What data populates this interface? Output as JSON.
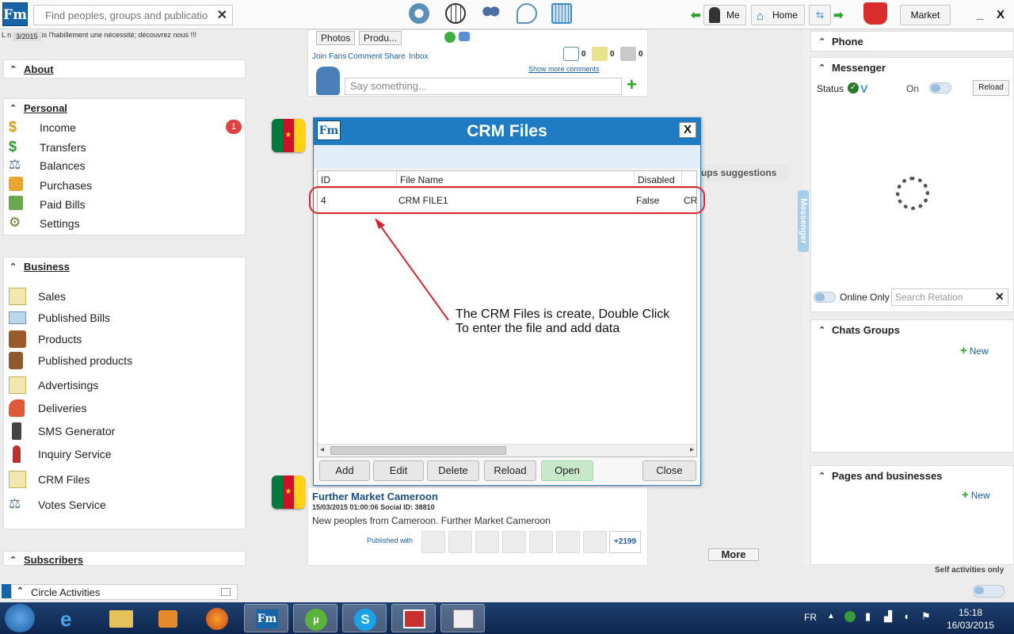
{
  "topbar": {
    "logo": "Fm",
    "search_placeholder": "Find peoples, groups and publications",
    "me_label": "Me",
    "home_label": "Home",
    "market_label": "Market",
    "minimize": "_",
    "close": "X"
  },
  "left": {
    "date_badge": "3/2015",
    "slogan": "L          n choix mais l'habillement une nécessité; découvrez nous !!!",
    "about": {
      "title": "About"
    },
    "personal": {
      "title": "Personal",
      "items": [
        {
          "label": "Income",
          "badge": "1"
        },
        {
          "label": "Transfers"
        },
        {
          "label": "Balances"
        },
        {
          "label": "Purchases"
        },
        {
          "label": "Paid Bills"
        },
        {
          "label": "Settings"
        }
      ]
    },
    "business": {
      "title": "Business",
      "items": [
        {
          "label": "Sales"
        },
        {
          "label": "Published Bills"
        },
        {
          "label": "Products"
        },
        {
          "label": "Published products"
        },
        {
          "label": "Advertisings"
        },
        {
          "label": "Deliveries"
        },
        {
          "label": "SMS Generator"
        },
        {
          "label": "Inquiry Service"
        },
        {
          "label": "CRM Files"
        },
        {
          "label": "Votes Service"
        }
      ]
    },
    "subscribers": {
      "title": "Subscribers"
    },
    "circle_activities": "Circle Activities"
  },
  "feed": {
    "tab_photos": "Photos",
    "tab_products": "Produ...",
    "actions": [
      "Join Fans",
      "Comment",
      "Share",
      "Inbox"
    ],
    "counts": [
      "0",
      "0",
      "0"
    ],
    "show_more": "Show more comments",
    "say_placeholder": "Say something...",
    "groups_suggestions": "ups suggestions",
    "card": {
      "title": "Further Market Cameroon",
      "meta": "15/03/2015 01:00:06   Social ID: 38810",
      "text": "New peoples from Cameroon. Further Market Cameroon",
      "published_with": "Published with",
      "more_count": "+2199"
    },
    "more_button": "More"
  },
  "right": {
    "phone": "Phone",
    "messenger": "Messenger",
    "status_label": "Status",
    "status_on": "On",
    "reload": "Reload",
    "messenger_tab": "Messenger",
    "online_only": "Online Only",
    "search_relation_placeholder": "Search Relation",
    "chats_groups": "Chats Groups",
    "new_label": "New",
    "pages_businesses": "Pages and businesses",
    "self_activities": "Self activities only"
  },
  "modal": {
    "logo": "Fm",
    "title": "CRM Files",
    "close": "X",
    "columns": [
      "ID",
      "File Name",
      "Disabled",
      ""
    ],
    "rows": [
      {
        "id": "4",
        "file_name": "CRM FILE1",
        "disabled": "False",
        "extra": "CRM"
      }
    ],
    "buttons": {
      "add": "Add",
      "edit": "Edit",
      "delete": "Delete",
      "reload": "Reload",
      "open": "Open",
      "close": "Close"
    }
  },
  "annotation": "The CRM Files is create, Double Click\nTo enter the file and add data",
  "taskbar": {
    "lang": "FR",
    "time": "15:18",
    "date": "16/03/2015"
  },
  "colors": {
    "accent": "#1f7bc2",
    "highlight_red": "#d9262c",
    "link_blue": "#1f5ea8",
    "badge_red": "#e04141",
    "open_green": "#c9e8c9"
  }
}
